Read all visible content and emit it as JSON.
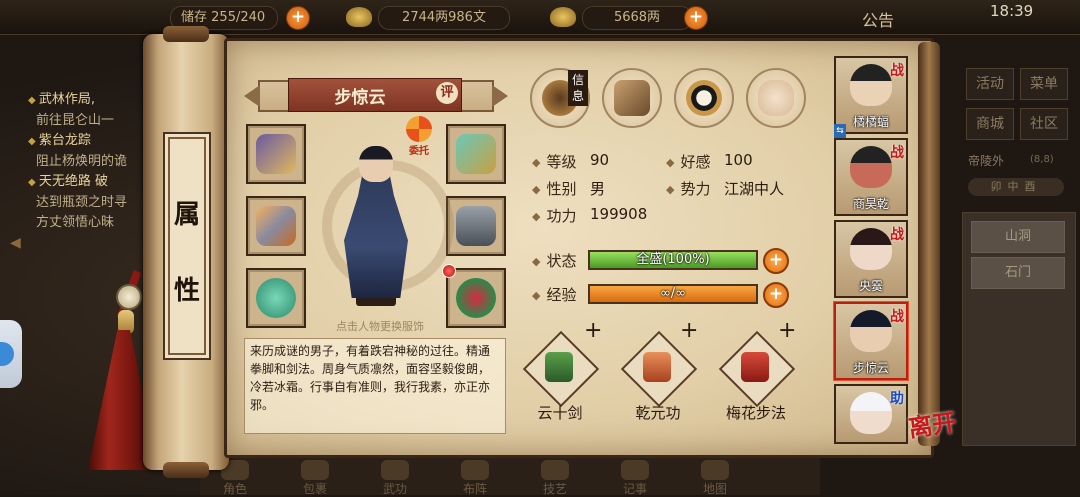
{
  "status_bar": {
    "time": "18:39"
  },
  "topbar": {
    "capacity_label": "储存",
    "capacity_value": "255/240",
    "copper": "2744两986文",
    "silver": "5668两",
    "notice": "公告"
  },
  "quests": [
    {
      "title": "武林作局,",
      "desc": "前往昆仑山一"
    },
    {
      "title": "紫台龙踪",
      "desc": "阻止杨焕明的诡"
    },
    {
      "title": "天无绝路 破",
      "desc": "达到瓶颈之时寻"
    },
    {
      "title": "",
      "desc": "方丈领悟心昧"
    }
  ],
  "right_menu": {
    "buttons": [
      "活动",
      "菜单",
      "商城",
      "社区"
    ],
    "location": "帝陵外",
    "location_coords": "(8,8)",
    "time_tabs": "卯中酉",
    "scenes": [
      "山洞",
      "石门"
    ]
  },
  "bottom_nav": [
    "角色",
    "包裹",
    "武功",
    "布阵",
    "技艺",
    "记事",
    "地图"
  ],
  "scroll_tab": {
    "chars": [
      "属",
      "性"
    ]
  },
  "character": {
    "name": "步惊云",
    "eval_badge": "评",
    "entrust_label": "委托",
    "change_hint": "点击人物更换服饰",
    "bio": "来历成谜的男子，有着跌宕神秘的过往。精通拳脚和剑法。周身气质凛然，面容坚毅俊朗，冷若冰霜。行事自有准则，我行我素，亦正亦邪。"
  },
  "info_tabs": [
    {
      "name": "信息",
      "icon": "hat-icon",
      "label": "信息"
    },
    {
      "name": "bag",
      "icon": "bag-icon"
    },
    {
      "name": "bagua",
      "icon": "yin-yang-icon"
    },
    {
      "name": "meridian",
      "icon": "body-meridian-icon"
    }
  ],
  "stats": {
    "level_label": "等级",
    "level": "90",
    "favor_label": "好感",
    "favor": "100",
    "gender_label": "性别",
    "gender": "男",
    "faction_label": "势力",
    "faction": "江湖中人",
    "power_label": "功力",
    "power": "199908",
    "state_label": "状态",
    "state_text": "全盛(100%)",
    "state_fill": 1.0,
    "exp_label": "经验",
    "exp_text": "∞/∞",
    "exp_fill": 1.0
  },
  "skills": [
    {
      "name": "云十剑",
      "color": "#3a8a3a"
    },
    {
      "name": "乾元功",
      "color": "#c8603a"
    },
    {
      "name": "梅花步法",
      "color": "#b02a20"
    }
  ],
  "skill_plus": "+",
  "roster": [
    {
      "name": "橘橘蝠",
      "tag": "战",
      "role": "battle"
    },
    {
      "name": "商昊乾",
      "tag": "战",
      "role": "battle"
    },
    {
      "name": "央霙",
      "tag": "战",
      "role": "battle"
    },
    {
      "name": "步惊云",
      "tag": "战",
      "role": "battle",
      "active": true
    },
    {
      "name": "",
      "tag": "助",
      "role": "help"
    }
  ],
  "leave_label": "离开",
  "colors": {
    "state_bar": "#6ab83a",
    "exp_bar": "#e8801a",
    "accent_red": "#b82014"
  }
}
